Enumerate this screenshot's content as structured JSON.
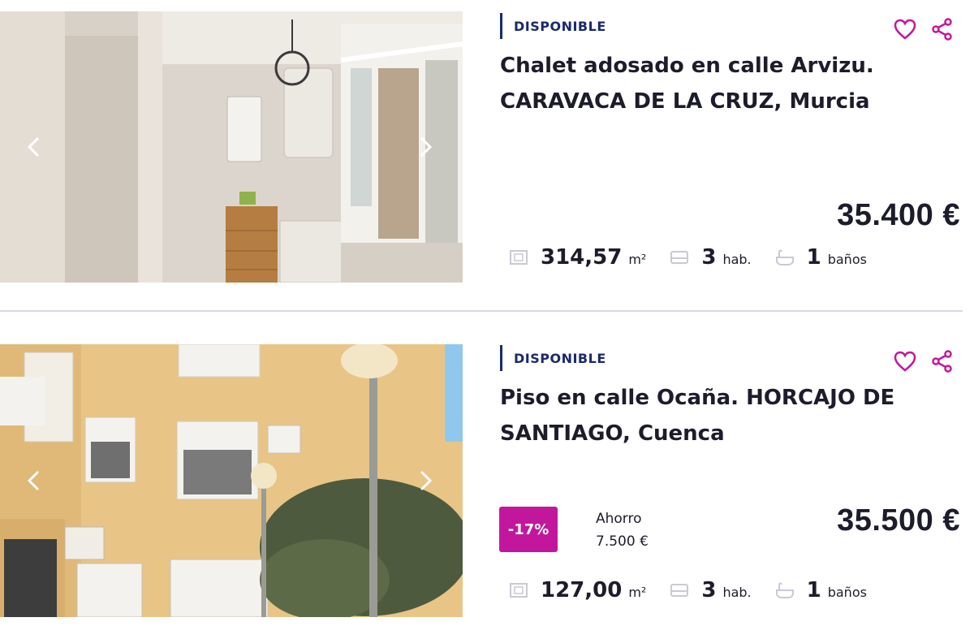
{
  "listings": [
    {
      "status": "DISPONIBLE",
      "title": "Chalet adosado en calle Arvizu. CARAVACA DE LA CRUZ, Murcia",
      "price": "35.400 €",
      "area_value": "314,57",
      "area_unit": "m²",
      "rooms_value": "3",
      "rooms_unit": "hab.",
      "baths_value": "1",
      "baths_unit": "baños"
    },
    {
      "status": "DISPONIBLE",
      "title": "Piso en calle Ocaña. HORCAJO DE SANTIAGO, Cuenca",
      "discount": "-17%",
      "saving_label": "Ahorro",
      "saving_value": "7.500 €",
      "price": "35.500 €",
      "area_value": "127,00",
      "area_unit": "m²",
      "rooms_value": "3",
      "rooms_unit": "hab.",
      "baths_value": "1",
      "baths_unit": "baños"
    }
  ],
  "icons": {
    "favorite": "heart-icon",
    "share": "share-icon",
    "area": "area-icon",
    "rooms": "bed-icon",
    "baths": "bathtub-icon",
    "prev": "chevron-left-icon",
    "next": "chevron-right-icon"
  },
  "colors": {
    "accent": "#c2179c",
    "status_navy": "#1b2a6b",
    "divider": "#d9d6ef"
  }
}
